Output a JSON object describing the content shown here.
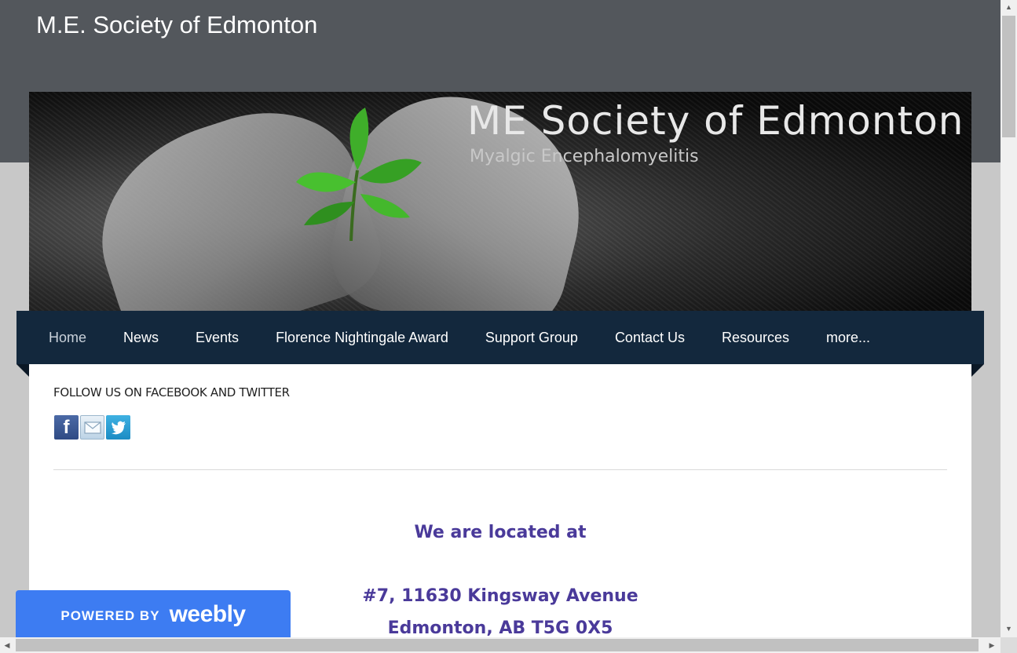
{
  "site": {
    "title": "M.E. Society of Edmonton"
  },
  "banner": {
    "title": "ME Society of Edmonton",
    "subtitle": "Myalgic Encephalomyelitis"
  },
  "nav": {
    "items": [
      {
        "label": "Home",
        "active": true
      },
      {
        "label": "News"
      },
      {
        "label": "Events"
      },
      {
        "label": "Florence Nightingale Award"
      },
      {
        "label": "Support Group"
      },
      {
        "label": "Contact Us"
      },
      {
        "label": "Resources"
      },
      {
        "label": "more..."
      }
    ]
  },
  "content": {
    "follow_heading": "FOLLOW US ON FACEBOOK AND TWITTER",
    "social": {
      "facebook_glyph": "f",
      "icons": [
        "facebook-icon",
        "mail-icon",
        "twitter-icon"
      ]
    },
    "located_heading": "We are located at",
    "address_line1": "#7, 11630 Kingsway Avenue",
    "address_line2": "Edmonton, AB  T5G 0X5"
  },
  "weebly": {
    "powered_by": "POWERED BY",
    "logo": "weebly"
  },
  "colors": {
    "top_band": "#53575c",
    "nav_bg": "#13283d",
    "address_text": "#4a3a9a",
    "weebly_blue": "#3d7cf2"
  },
  "scrollbar": {
    "up": "▲",
    "down": "▼",
    "left": "◀",
    "right": "▶"
  }
}
